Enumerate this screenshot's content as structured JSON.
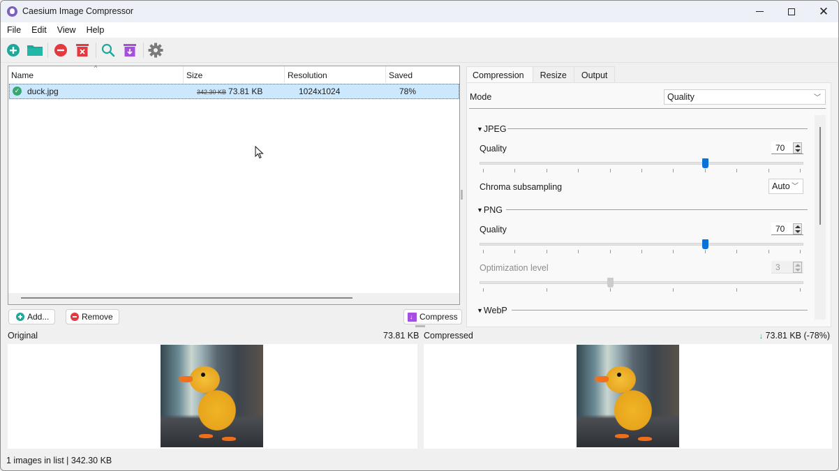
{
  "window": {
    "title": "Caesium Image Compressor",
    "controls": {
      "minimize": "minimize",
      "maximize": "maximize",
      "close": "close"
    }
  },
  "menu": [
    "File",
    "Edit",
    "View",
    "Help"
  ],
  "toolbar": {
    "buttons": [
      {
        "icon": "add-circle-icon",
        "color": "#1fa89a"
      },
      {
        "icon": "folder-icon",
        "color": "#1fa89a"
      },
      {
        "icon": "remove-circle-icon",
        "color": "#e3393f"
      },
      {
        "icon": "clear-list-icon",
        "color": "#e3393f"
      },
      {
        "icon": "search-icon",
        "color": "#1fa89a"
      },
      {
        "icon": "compress-icon",
        "color": "#a64ee0"
      },
      {
        "icon": "gear-icon",
        "color": "#7a7a7a"
      }
    ]
  },
  "file_list": {
    "columns": [
      "Name",
      "Size",
      "Resolution",
      "Saved"
    ],
    "sort_indicator": "^",
    "rows": [
      {
        "name": "duck.jpg",
        "status": "done",
        "original_size": "342.30 KB",
        "compressed_size": "73.81 KB",
        "resolution": "1024x1024",
        "saved": "78%"
      }
    ]
  },
  "list_buttons": {
    "add": "Add...",
    "remove": "Remove",
    "compress": "Compress"
  },
  "settings": {
    "tabs": [
      "Compression",
      "Resize",
      "Output"
    ],
    "active_tab": "Compression",
    "mode_label": "Mode",
    "mode_value": "Quality",
    "jpeg": {
      "title": "JPEG",
      "quality_label": "Quality",
      "quality_value": "70",
      "quality_fraction": 0.7,
      "chroma_label": "Chroma subsampling",
      "chroma_value": "Auto"
    },
    "png": {
      "title": "PNG",
      "quality_label": "Quality",
      "quality_value": "70",
      "quality_fraction": 0.7,
      "optimization_label": "Optimization level",
      "optimization_value": "3",
      "optimization_fraction": 0.4
    },
    "webp": {
      "title": "WebP"
    }
  },
  "preview": {
    "original_label": "Original",
    "original_size": "73.81 KB",
    "compressed_label": "Compressed",
    "compressed_info": "↓ 73.81 KB (-78%)",
    "compressed_info_color": "#3aa672"
  },
  "status_bar": "1 images in list | 342.30 KB"
}
